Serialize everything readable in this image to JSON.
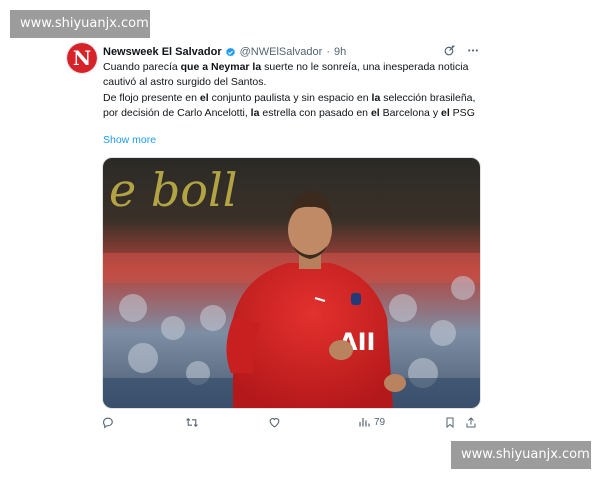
{
  "watermark": {
    "top": "www.shiyuanjx.com",
    "bottom": "www.shiyuanjx.com"
  },
  "tweet": {
    "avatar_letter": "N",
    "author_name": "Newsweek El Salvador",
    "handle": "@NWElSalvador",
    "separator": "·",
    "time": "9h",
    "text_line1_parts": [
      "Cuando parecía ",
      "que a Neymar la",
      " suerte no le sonreía, una inesperada noticia cautivó al astro surgido del Santos."
    ],
    "text_line2_parts": [
      "De flojo presente en ",
      "el",
      " conjunto paulista y sin espacio en ",
      "la",
      " selección brasileña, por decisión de Carlo Ancelotti, ",
      "la",
      " estrella con pasado en ",
      "el",
      " Barcelona y ",
      "el",
      " PSG"
    ],
    "show_more": "Show more",
    "views_count": "79",
    "photo_banner_text": "e boll"
  },
  "icons": [
    "verified-icon",
    "grok-icon",
    "more-icon",
    "reply-icon",
    "retweet-icon",
    "like-icon",
    "views-icon",
    "bookmark-icon",
    "share-icon"
  ],
  "colors": {
    "link": "#1d9bf0",
    "verified": "#1d9bf0",
    "brand_red": "#d6232a",
    "muted": "#536471"
  }
}
